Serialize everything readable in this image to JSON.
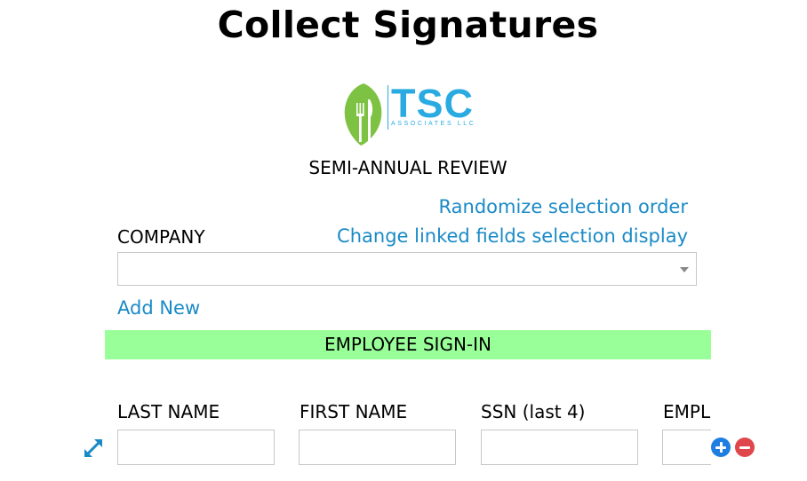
{
  "page": {
    "title": "Collect Signatures"
  },
  "logo": {
    "text": "TSC",
    "subtext": "ASSOCIATES LLC",
    "icon": "leaf-fork-knife-icon",
    "colors": {
      "leaf": "#7dc242",
      "text": "#29abe2"
    }
  },
  "form": {
    "subtitle": "SEMI-ANNUAL REVIEW",
    "links": {
      "randomize": "Randomize selection order",
      "linked_fields": "Change linked fields selection display",
      "add_new": "Add New"
    },
    "company": {
      "label": "COMPANY",
      "value": ""
    },
    "section": {
      "title": "EMPLOYEE SIGN-IN",
      "color": "#99ff99"
    },
    "columns": [
      {
        "label": "LAST NAME",
        "value": ""
      },
      {
        "label": "FIRST NAME",
        "value": ""
      },
      {
        "label": "SSN (last 4)",
        "value": ""
      },
      {
        "label": "EMPL",
        "value": ""
      }
    ],
    "icons": {
      "expand": "expand-arrows-icon",
      "add": "plus-circle-icon",
      "remove": "minus-circle-icon"
    },
    "accent_color": "#1a8ac6"
  }
}
